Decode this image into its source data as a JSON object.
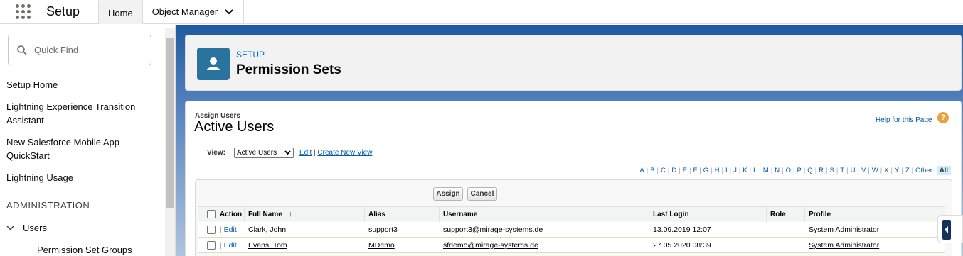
{
  "topbar": {
    "app_name": "Setup",
    "tabs": [
      {
        "label": "Home"
      },
      {
        "label": "Object Manager"
      }
    ]
  },
  "sidebar": {
    "search_placeholder": "Quick Find",
    "items": [
      {
        "label": "Setup Home"
      },
      {
        "label": "Lightning Experience Transition Assistant"
      },
      {
        "label": "New Salesforce Mobile App QuickStart"
      },
      {
        "label": "Lightning Usage"
      }
    ],
    "section": "ADMINISTRATION",
    "group": "Users",
    "sub_item": "Permission Set Groups"
  },
  "header": {
    "eyebrow": "SETUP",
    "title": "Permission Sets"
  },
  "content": {
    "eyebrow": "Assign Users",
    "title": "Active Users",
    "help_link": "Help for this Page",
    "view_label": "View:",
    "view_selected": "Active Users",
    "edit_link": "Edit",
    "create_link": "Create New View",
    "letters": [
      "A",
      "B",
      "C",
      "D",
      "E",
      "F",
      "G",
      "H",
      "I",
      "J",
      "K",
      "L",
      "M",
      "N",
      "O",
      "P",
      "Q",
      "R",
      "S",
      "T",
      "U",
      "V",
      "W",
      "X",
      "Y",
      "Z",
      "Other"
    ],
    "all_label": "All",
    "assign_button": "Assign",
    "cancel_button": "Cancel",
    "columns": {
      "action": "Action",
      "full_name": "Full Name",
      "sort_indicator": "↑",
      "alias": "Alias",
      "username": "Username",
      "last_login": "Last Login",
      "role": "Role",
      "profile": "Profile"
    },
    "rows": [
      {
        "action": "Edit",
        "full_name": "Clark, John",
        "alias": "support3",
        "username": "support3@mirage-systems.de",
        "last_login": "13.09.2019 12:07",
        "role": "",
        "profile": "System Administrator"
      },
      {
        "action": "Edit",
        "full_name": "Evans, Tom",
        "alias": "MDemo",
        "username": "sfdemo@mirage-systems.de",
        "last_login": "27.05.2020 08:39",
        "role": "",
        "profile": "System Administrator"
      }
    ]
  },
  "colors": {
    "accent": "#0070d2",
    "header_icon": "#2a739e",
    "link": "#015ba7"
  }
}
